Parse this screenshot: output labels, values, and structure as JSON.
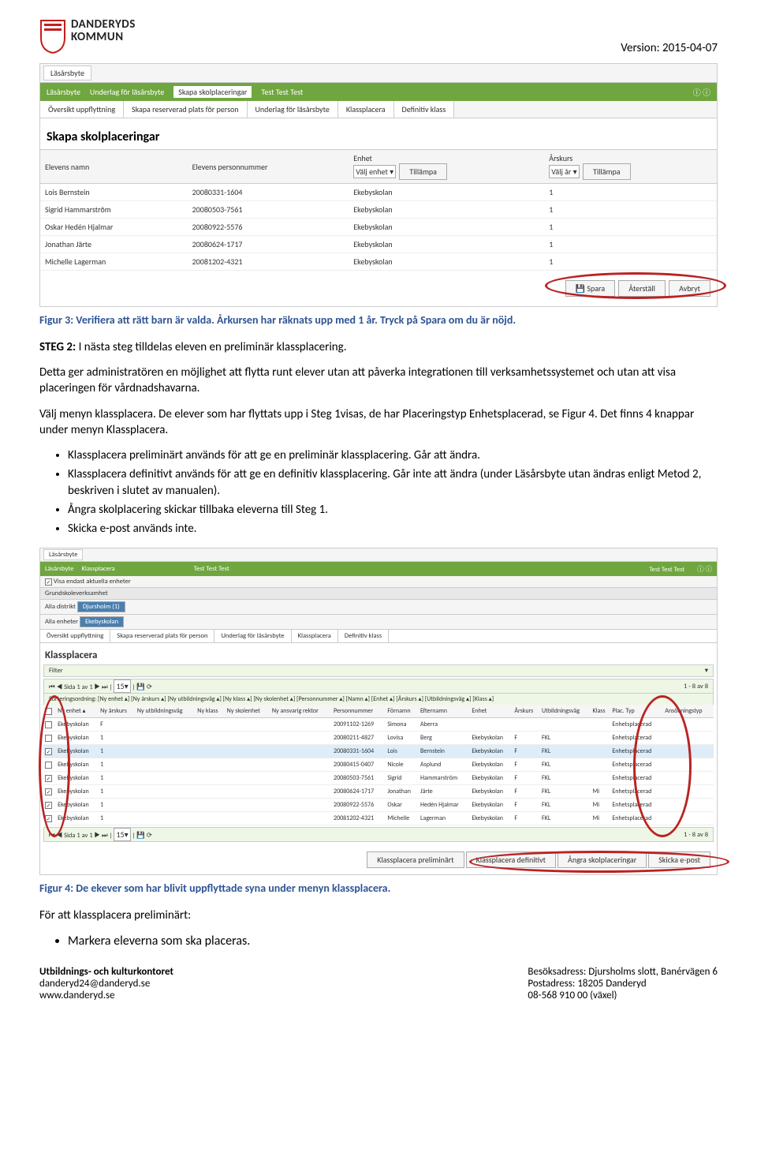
{
  "header": {
    "logo_line1": "DANDERYDS",
    "logo_line2": "KOMMUN",
    "version": "Version: 2015-04-07"
  },
  "ss1": {
    "windowTab": "Läsårsbyte",
    "breadcrumb": [
      "Läsårsbyte",
      "Underlag för läsårsbyte",
      "Skapa skolplaceringar"
    ],
    "centerName": "Test Test Test",
    "subtabs": [
      "Översikt uppflyttning",
      "Skapa reserverad plats för person",
      "Underlag för läsårsbyte",
      "Klassplacera",
      "Definitiv klass"
    ],
    "title": "Skapa skolplaceringar",
    "cols": [
      "Elevens namn",
      "Elevens personnummer",
      "Enhet",
      "Årskurs"
    ],
    "enhetPlaceholder": "Välj enhet",
    "tillampa": "Tillämpa",
    "arPlaceholder": "Välj år",
    "rows": [
      {
        "name": "Lois Bernstein",
        "pnr": "20080331-1604",
        "enhet": "Ekebyskolan",
        "ak": "1"
      },
      {
        "name": "Sigrid Hammarström",
        "pnr": "20080503-7561",
        "enhet": "Ekebyskolan",
        "ak": "1"
      },
      {
        "name": "Oskar Hedén Hjalmar",
        "pnr": "20080922-5576",
        "enhet": "Ekebyskolan",
        "ak": "1"
      },
      {
        "name": "Jonathan Järte",
        "pnr": "20080624-1717",
        "enhet": "Ekebyskolan",
        "ak": "1"
      },
      {
        "name": "Michelle Lagerman",
        "pnr": "20081202-4321",
        "enhet": "Ekebyskolan",
        "ak": "1"
      }
    ],
    "btns": {
      "spara": "Spara",
      "aterstall": "Återställ",
      "avbryt": "Avbryt"
    }
  },
  "caption1": "Figur 3: Verifiera att rätt barn är valda. Årkursen har räknats upp med 1 år. Tryck på Spara om du är nöjd.",
  "step2_label": "STEG 2:",
  "step2_text": " I nästa steg tilldelas eleven en preliminär klassplacering.",
  "para1": "Detta ger administratören en möjlighet att flytta runt elever utan att påverka integrationen till verksamhetssystemet och utan att visa placeringen för vårdnadshavarna.",
  "para2": "Välj menyn klassplacera. De elever som har flyttats upp i Steg 1visas, de har Placeringstyp Enhetsplacerad, se Figur 4. Det finns 4 knappar under menyn Klassplacera.",
  "bullets1": [
    "Klassplacera preliminärt används för att ge en preliminär klassplacering. Går att ändra.",
    "Klassplacera definitivt används för att ge en definitiv klassplacering. Går inte att ändra (under Läsårsbyte utan ändras enligt Metod 2, beskriven i slutet av manualen).",
    "Ångra skolplacering skickar tillbaka eleverna till Steg 1.",
    "Skicka e-post används inte."
  ],
  "ss2": {
    "windowTab": "Läsårsbyte",
    "breadcrumb": [
      "Läsårsbyte",
      "Klassplacera"
    ],
    "centerName": "Test Test Test",
    "chkLabel": "Visa endast aktuella enheter",
    "grundRow": "Grundskoleverksamhet",
    "distriktLabel": "Alla distrikt",
    "distriktChip": "Djursholm (1)",
    "enheterLabel": "Alla enheter",
    "enheterChip": "Ekebyskolan",
    "subtabs": [
      "Översikt uppflyttning",
      "Skapa reserverad plats för person",
      "Underlag för läsårsbyte",
      "Klassplacera",
      "Definitiv klass"
    ],
    "title": "Klassplacera",
    "filter": "Filter",
    "pageInfo": "Sida  1  av 1",
    "perPage": "15",
    "totalInfo": "1 - 8 av 8",
    "sortLabel": "Sorteringsordning:",
    "sortItems": [
      "Ny enhet",
      "Ny årskurs",
      "Ny utbildningsväg",
      "Ny klass",
      "Ny skolenhet",
      "Personnummer",
      "Namn",
      "Enhet",
      "Årskurs",
      "Utbildningsväg",
      "Klass"
    ],
    "cols": [
      "",
      "Ny enhet",
      "Ny årskurs",
      "Ny utbildningsväg",
      "Ny klass",
      "Ny skolenhet",
      "Ny ansvarig rektor",
      "Personnummer",
      "Förnamn",
      "Efternamn",
      "Enhet",
      "Årskurs",
      "Utbildningsväg",
      "Klass",
      "Plac. Typ",
      "Ansökningstyp"
    ],
    "rows": [
      {
        "ck": false,
        "nyenhet": "Ekebyskolan",
        "nyak": "F",
        "pnr": "20091102-1269",
        "fn": "Simona",
        "en": "Aberra",
        "enhet": "",
        "ak": "",
        "uv": "",
        "kl": "",
        "typ": "Enhetsplacerad"
      },
      {
        "ck": false,
        "nyenhet": "Ekebyskolan",
        "nyak": "1",
        "pnr": "20080211-4827",
        "fn": "Lovisa",
        "en": "Berg",
        "enhet": "Ekebyskolan",
        "ak": "F",
        "uv": "FKL",
        "kl": "",
        "typ": "Enhetsplacerad"
      },
      {
        "ck": true,
        "nyenhet": "Ekebyskolan",
        "nyak": "1",
        "pnr": "20080331-1604",
        "fn": "Lois",
        "en": "Bernstein",
        "enhet": "Ekebyskolan",
        "ak": "F",
        "uv": "FKL",
        "kl": "",
        "typ": "Enhetsplacerad",
        "hi": true
      },
      {
        "ck": false,
        "nyenhet": "Ekebyskolan",
        "nyak": "1",
        "pnr": "20080415-0407",
        "fn": "Nicole",
        "en": "Asplund",
        "enhet": "Ekebyskolan",
        "ak": "F",
        "uv": "FKL",
        "kl": "",
        "typ": "Enhetsplacerad"
      },
      {
        "ck": true,
        "nyenhet": "Ekebyskolan",
        "nyak": "1",
        "pnr": "20080503-7561",
        "fn": "Sigrid",
        "en": "Hammarström",
        "enhet": "Ekebyskolan",
        "ak": "F",
        "uv": "FKL",
        "kl": "",
        "typ": "Enhetsplacerad"
      },
      {
        "ck": true,
        "nyenhet": "Ekebyskolan",
        "nyak": "1",
        "pnr": "20080624-1717",
        "fn": "Jonathan",
        "en": "Järte",
        "enhet": "Ekebyskolan",
        "ak": "F",
        "uv": "FKL",
        "kl": "Mi",
        "typ": "Enhetsplacerad"
      },
      {
        "ck": true,
        "nyenhet": "Ekebyskolan",
        "nyak": "1",
        "pnr": "20080922-5576",
        "fn": "Oskar",
        "en": "Hedén Hjalmar",
        "enhet": "Ekebyskolan",
        "ak": "F",
        "uv": "FKL",
        "kl": "Mi",
        "typ": "Enhetsplacerad"
      },
      {
        "ck": true,
        "nyenhet": "Ekebyskolan",
        "nyak": "1",
        "pnr": "20081202-4321",
        "fn": "Michelle",
        "en": "Lagerman",
        "enhet": "Ekebyskolan",
        "ak": "F",
        "uv": "FKL",
        "kl": "Mi",
        "typ": "Enhetsplacerad"
      }
    ],
    "btns": [
      "Klassplacera preliminärt",
      "Klassplacera definitivt",
      "Ångra skolplaceringar",
      "Skicka e-post"
    ]
  },
  "caption2": "Figur 4: De ekever som har blivit uppflyttade syna under menyn klassplacera.",
  "para3": "För att klassplacera preliminärt:",
  "finalBullet": "Markera eleverna som ska placeras.",
  "footer": {
    "left1": "Utbildnings- och kulturkontoret",
    "left2": "danderyd24@danderyd.se",
    "left3": "www.danderyd.se",
    "right1": "Besöksadress: Djursholms slott, Banérvägen 6",
    "right2": "Postadress: 18205 Danderyd",
    "right3": "08-568 910 00 (växel)"
  }
}
